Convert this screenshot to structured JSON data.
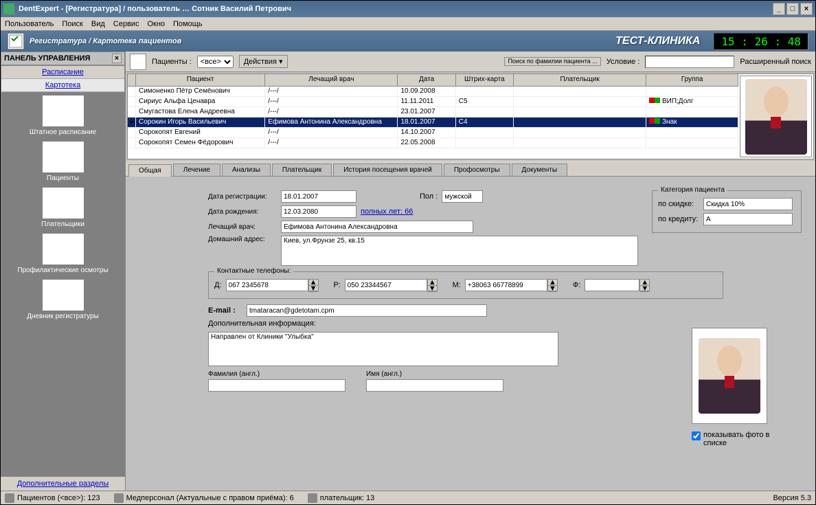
{
  "window": {
    "title": "DentExpert - [Регистратура]   / пользователь … Сотник Василий Петрович"
  },
  "menu": [
    "Пользователь",
    "Поиск",
    "Вид",
    "Сервис",
    "Окно",
    "Помощь"
  ],
  "header": {
    "title": "Регистратура / Картотека пациентов",
    "clinic": "ТЕСТ-КЛИНИКА",
    "clock": "15 : 26 : 48"
  },
  "sidebar": {
    "title": "ПАНЕЛЬ УПРАВЛЕНИЯ",
    "links": [
      "Расписание",
      "Картотека"
    ],
    "items": [
      {
        "label": "Штатное расписание"
      },
      {
        "label": "Пациенты"
      },
      {
        "label": "Плательщики"
      },
      {
        "label": "Профилактические осмотры"
      },
      {
        "label": "Дневник регистратуры"
      }
    ],
    "bottom": "Дополнительные разделы"
  },
  "toolbar": {
    "patients_lbl": "Пациенты :",
    "patients_sel": "<все>",
    "actions_lbl": "Действия",
    "search_hint": "Поиск по фамилии пациента ...",
    "cond_lbl": "Условие :",
    "cond_val": "",
    "adv": "Расширенный поиск"
  },
  "grid": {
    "cols": [
      "Пациент",
      "Лечащий врач",
      "Дата",
      "Штрих-карта",
      "Плательщик",
      "Группа"
    ],
    "rows": [
      {
        "patient": "Симоненко Пётр Семёнович",
        "doctor": "/---/",
        "date": "10.09.2008",
        "card": "",
        "payer": "",
        "group": "",
        "sel": false
      },
      {
        "patient": "Сириус Альфа Ценавра",
        "doctor": "/---/",
        "date": "11.11.2011",
        "card": "C5",
        "payer": "",
        "group": "ВИП;Долг",
        "groupcolor": "#d00",
        "sel": false
      },
      {
        "patient": "Смугастова Елена Андреевна",
        "doctor": "/---/",
        "date": "23.01.2007",
        "card": "",
        "payer": "",
        "group": "",
        "sel": false
      },
      {
        "patient": "Сорокин Игорь Васильевич",
        "doctor": "Ефимова Антонина Александровна",
        "date": "18.01.2007",
        "card": "C4",
        "payer": "",
        "group": "Знак",
        "groupcolor": "#d00",
        "sel": true
      },
      {
        "patient": "Сорокопят Евгений",
        "doctor": "/---/",
        "date": "14.10.2007",
        "card": "",
        "payer": "",
        "group": "",
        "sel": false
      },
      {
        "patient": "Сорокопят Семен Фёдорович",
        "doctor": "/---/",
        "date": "22.05.2008",
        "card": "",
        "payer": "",
        "group": "",
        "sel": false
      }
    ]
  },
  "tabs": [
    "Общая",
    "Лечение",
    "Анализы",
    "Плательщик",
    "История посещения врачей",
    "Профосмотры",
    "Документы"
  ],
  "form": {
    "reg_lbl": "Дата регистрации:",
    "reg": "18.01.2007",
    "sex_lbl": "Пол :",
    "sex": "мужской",
    "birth_lbl": "Дата рождения:",
    "birth": "12.03.2080",
    "age_lbl": "полных лет:",
    "age": "66",
    "doctor_lbl": "Лечащий врач:",
    "doctor": "Ефимова Антонина Александровна",
    "addr_lbl": "Домашний адрес:",
    "addr": "Киев, ул.Фрунзе 25, кв.15",
    "phones_legend": "Контактные телефоны:",
    "ph_d_lbl": "Д:",
    "ph_d": "067 2345678",
    "ph_r_lbl": "Р:",
    "ph_r": "050 23344567",
    "ph_m_lbl": "М:",
    "ph_m": "+38063 66778899",
    "ph_f_lbl": "Ф:",
    "ph_f": "",
    "email_lbl": "E-mail :",
    "email": "tmataracan@gdetotam.cpm",
    "info_lbl": "Дополнительная информация:",
    "info": "Направлен от Клиники \"Улыбка\"",
    "ln_en_lbl": "Фамилия (англ.)",
    "ln_en": "",
    "fn_en_lbl": "Имя (англ.)",
    "fn_en": "",
    "cat_legend": "Категория пациента",
    "disc_lbl": "по скидке:",
    "disc": "Скидка 10%",
    "cred_lbl": "по кредиту:",
    "cred": "A",
    "show_photo": "показывать фото в списке"
  },
  "status": {
    "s1": "Пациентов (<все>): 123",
    "s2": "Медперсонал (Актуальные с правом приёма): 6",
    "s3": "плательщик: 13",
    "ver": "Версия 5.3"
  }
}
